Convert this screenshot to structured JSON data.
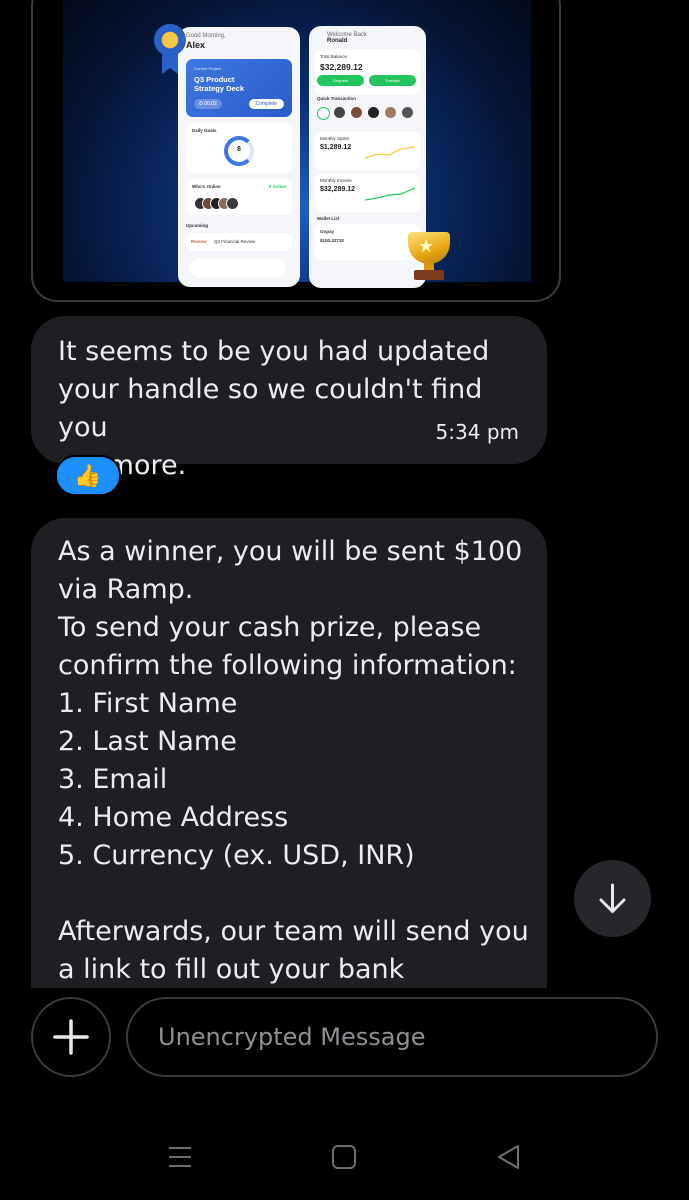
{
  "image_preview": {
    "phone1": {
      "greeting": "Good Morning,",
      "name": "Alex",
      "card_label": "Current Project",
      "card_title": "Q3 Product Strategy Deck",
      "card_time": "⏱ 00:02",
      "card_button": "Complete",
      "daily_goals": "Daily Goals",
      "goals_value": "8",
      "whos_online": "Who's Online",
      "online_count": "3 Active",
      "upcoming": "Upcoming",
      "upcoming_tag": "Review",
      "upcoming_item": "Q3 Financial Review"
    },
    "phone2": {
      "welcome": "Welcome Back",
      "name": "Ronald",
      "total_balance_label": "Total Balance",
      "total_balance": "$32,289.12",
      "request": "Request",
      "transfer": "Transfer",
      "quick_transaction": "Quick Transaction",
      "monthly_spent_label": "Monthly Spent",
      "monthly_spent": "$1,289.12",
      "monthly_income_label": "Monthly Income",
      "monthly_income": "$32,289.12",
      "wallet_list": "Wallet List",
      "wallet_name": "Gopay",
      "wallet_value": "$100.32718"
    }
  },
  "messages": [
    {
      "lines": [
        "It seems to be you had updated",
        "your handle so we couldn't find you",
        "anymore."
      ],
      "time": "5:34 pm",
      "reaction": "👍"
    },
    {
      "lines": [
        "As a winner, you will be sent $100",
        "via Ramp.",
        "To send your cash prize, please",
        "confirm the following information:",
        "1. First Name",
        "2. Last Name",
        "3. Email",
        "4. Home Address",
        "5. Currency (ex. USD, INR)",
        "",
        "Afterwards, our team will send you",
        "a link to fill out your bank"
      ]
    }
  ],
  "composer": {
    "placeholder": "Unencrypted Message"
  },
  "icons": {
    "scroll_down": "arrow-down-icon",
    "attach": "plus-icon",
    "nav_recents": "recents-icon",
    "nav_home": "home-icon",
    "nav_back": "back-icon"
  }
}
